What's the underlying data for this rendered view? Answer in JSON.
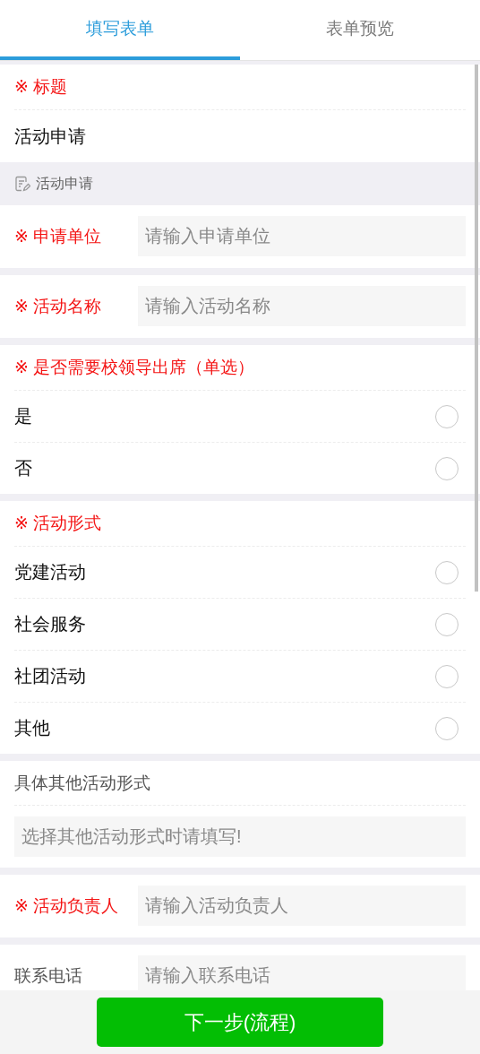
{
  "tabs": [
    {
      "label": "填写表单",
      "selected": true
    },
    {
      "label": "表单预览",
      "selected": false
    }
  ],
  "sections": [
    {
      "kind": "title",
      "label": "※ 标题",
      "required": true,
      "value": "活动申请"
    },
    {
      "kind": "header",
      "text": "活动申请"
    },
    {
      "kind": "field",
      "label": "※ 申请单位",
      "required": true,
      "placeholder": "请输入申请单位"
    },
    {
      "kind": "field",
      "label": "※ 活动名称",
      "required": true,
      "placeholder": "请输入活动名称"
    },
    {
      "kind": "radio",
      "label": "※ 是否需要校领导出席（单选）",
      "required": true,
      "options": [
        {
          "label": "是",
          "selected": false
        },
        {
          "label": "否",
          "selected": false
        }
      ]
    },
    {
      "kind": "radio",
      "label": "※ 活动形式",
      "required": true,
      "options": [
        {
          "label": "党建活动",
          "selected": false
        },
        {
          "label": "社会服务",
          "selected": false
        },
        {
          "label": "社团活动",
          "selected": false
        },
        {
          "label": "其他",
          "selected": false
        }
      ]
    },
    {
      "kind": "stacked",
      "label": "具体其他活动形式",
      "required": false,
      "placeholder": "选择其他活动形式时请填写!"
    },
    {
      "kind": "field",
      "label": "※ 活动负责人",
      "required": true,
      "placeholder": "请输入活动负责人"
    },
    {
      "kind": "field",
      "label": "联系电话",
      "required": false,
      "placeholder": "请输入联系电话"
    }
  ],
  "next_button": "下一步(流程)"
}
